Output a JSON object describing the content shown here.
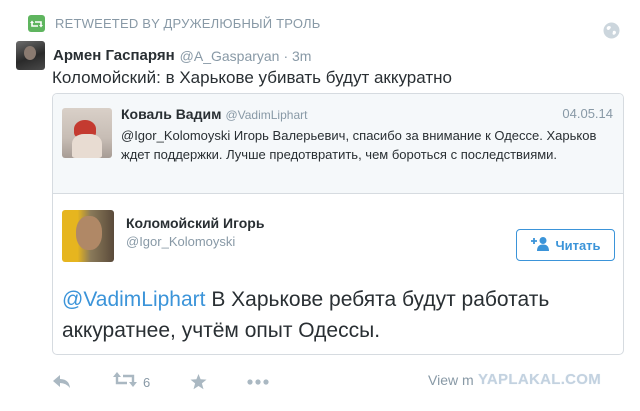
{
  "retweet": {
    "label": "RETWEETED BY ДРУЖЕЛЮБНЫЙ ТРОЛЬ"
  },
  "author": {
    "name": "Армен Гаспарян",
    "handle": "@A_Gasparyan",
    "time": "· 3m"
  },
  "tweet": {
    "text": "Коломойский: в Харькове убивать будут аккуратно"
  },
  "quote1": {
    "name": "Коваль Вадим",
    "handle": "@VadimLiphart",
    "date": "04.05.14",
    "text": "@Igor_Kolomoyski Игорь Валерьевич, спасибо за внимание к Одессе. Харьков ждет поддержки. Лучше предотвратить, чем бороться с последствиями."
  },
  "quote2": {
    "name": "Коломойский Игорь",
    "handle": "@Igor_Kolomoyski",
    "follow_label": "Читать",
    "mention": "@VadimLiphart",
    "text": " В Харькове ребята будут работать аккуратнее, учтём опыт Одессы."
  },
  "actions": {
    "retweet_count": "6",
    "view_more": "View m"
  },
  "watermark": {
    "text": "YAPLAKAL.COM"
  },
  "colors": {
    "accent": "#3b94d9",
    "muted": "#8899a6",
    "retweet_green": "#5fb55f"
  },
  "icons": [
    "retweet-badge-icon",
    "globe-icon",
    "follow-user-icon",
    "reply-icon",
    "retweet-icon",
    "favorite-star-icon",
    "more-dots-icon"
  ]
}
